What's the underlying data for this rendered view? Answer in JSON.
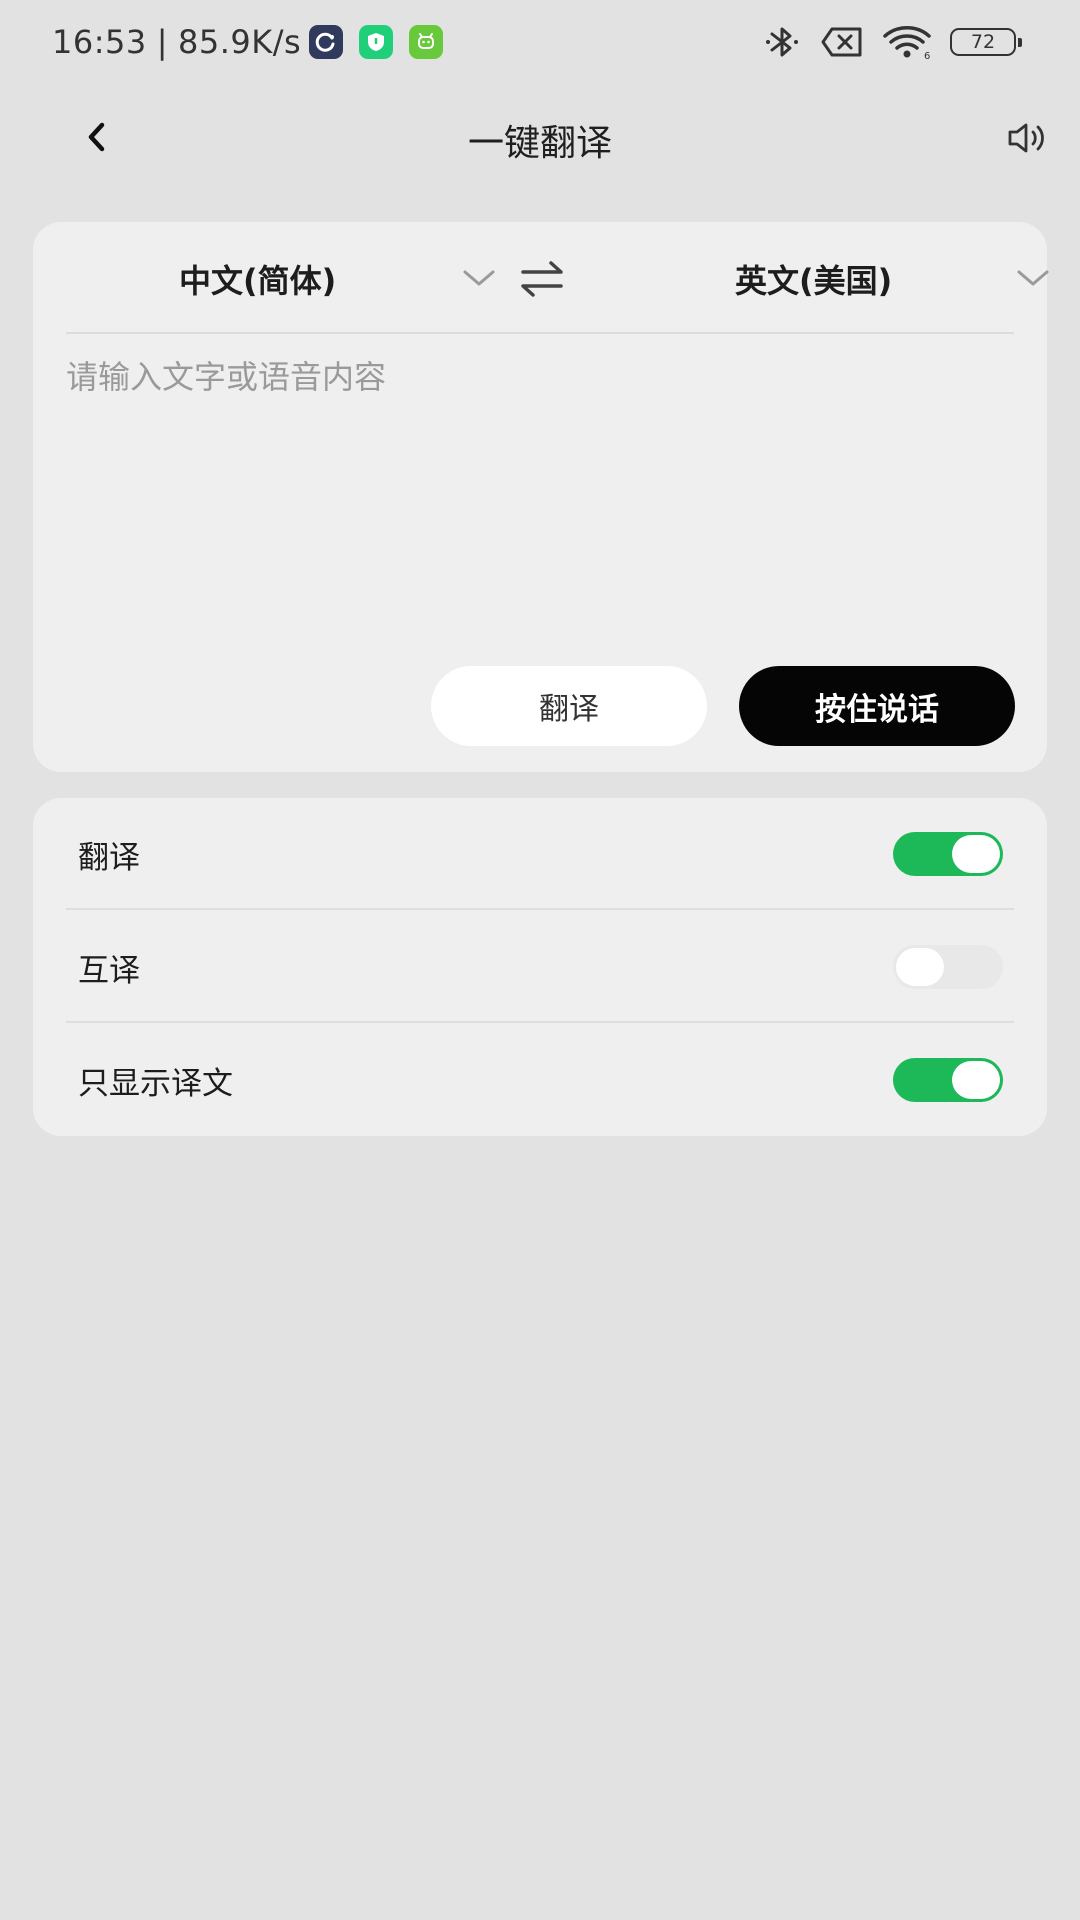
{
  "status_bar": {
    "time": "16:53",
    "separator": "|",
    "network_speed": "85.9K/s",
    "battery": "72",
    "app_icons": [
      "cleaner-app-icon",
      "security-app-icon",
      "android-app-icon"
    ],
    "system_icons": [
      "bluetooth-icon",
      "no-sim-icon",
      "wifi-icon",
      "battery-icon"
    ]
  },
  "header": {
    "title": "一键翻译",
    "back_icon": "back-arrow-icon",
    "speaker_icon": "speaker-icon"
  },
  "translate": {
    "source_language": "中文(简体)",
    "target_language": "英文(美国)",
    "swap_icon": "swap-arrows-icon",
    "input_value": "",
    "input_placeholder": "请输入文字或语音内容",
    "translate_label": "翻译",
    "hold_to_talk_label": "按住说话"
  },
  "settings": {
    "items": [
      {
        "label": "翻译",
        "enabled": true
      },
      {
        "label": "互译",
        "enabled": false
      },
      {
        "label": "只显示译文",
        "enabled": true
      }
    ]
  },
  "colors": {
    "background": "#e2e2e2",
    "card": "#efefef",
    "accent_green": "#1db857",
    "button_dark": "#050505",
    "placeholder": "#9a9a9a"
  }
}
